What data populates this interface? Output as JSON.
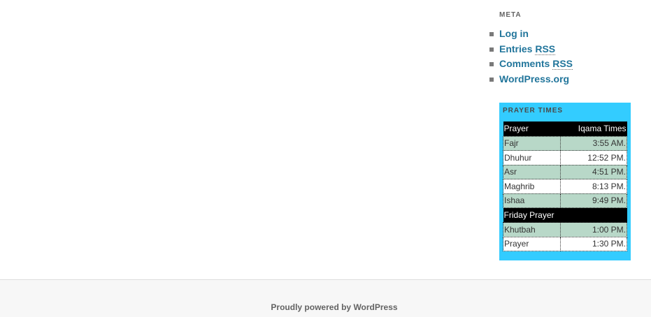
{
  "meta": {
    "title": "META",
    "items": [
      {
        "label": "Log in"
      },
      {
        "label": "Entries ",
        "abbr": "RSS"
      },
      {
        "label": "Comments ",
        "abbr": "RSS"
      },
      {
        "label": "WordPress.org"
      }
    ]
  },
  "prayer": {
    "title": "PRAYER TIMES",
    "header": {
      "col1": "Prayer",
      "col2": "Iqama Times"
    },
    "rows": [
      {
        "name": "Fajr",
        "time": "3:55 AM."
      },
      {
        "name": "Dhuhur",
        "time": "12:52 PM."
      },
      {
        "name": "Asr",
        "time": "4:51 PM."
      },
      {
        "name": "Maghrib",
        "time": "8:13 PM."
      },
      {
        "name": "Ishaa",
        "time": "9:49 PM."
      }
    ],
    "friday_header": "Friday Prayer",
    "friday_rows": [
      {
        "name": "Khutbah",
        "time": "1:00 PM."
      },
      {
        "name": "Prayer",
        "time": "1:30 PM."
      }
    ]
  },
  "footer": {
    "powered_by": "Proudly powered by WordPress"
  },
  "colors": {
    "link": "#21759b",
    "prayer_widget_bg": "#33ccff",
    "row_alt": "#b8d8c8"
  }
}
